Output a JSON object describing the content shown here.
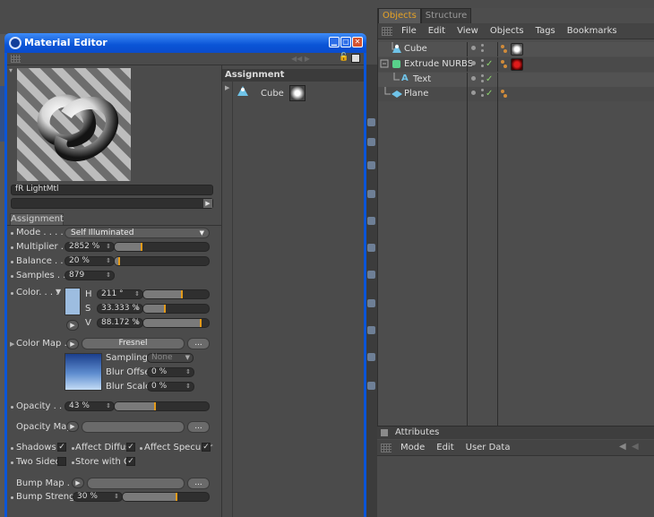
{
  "object_manager": {
    "tabs": [
      "Objects",
      "Structure"
    ],
    "menu": [
      "File",
      "Edit",
      "View",
      "Objects",
      "Tags",
      "Bookmarks"
    ],
    "objects": [
      {
        "name": "Cube",
        "icon": "cube-icon",
        "check": false
      },
      {
        "name": "Extrude NURBS",
        "icon": "extrude-nurbs-icon",
        "check": true
      },
      {
        "name": "Text",
        "icon": "text-spline-icon",
        "check": true
      },
      {
        "name": "Plane",
        "icon": "plane-icon",
        "check": true
      }
    ]
  },
  "attributes": {
    "title": "Attributes",
    "menu": [
      "Mode",
      "Edit",
      "User Data"
    ]
  },
  "material_editor": {
    "title": "Material Editor",
    "material_name": "fR LightMtl",
    "assignment_header": "Assignment",
    "assignment_item": "Cube",
    "tab": "Assignment",
    "mode": {
      "label": "Mode . . . . .",
      "value": "Self Illuminated"
    },
    "multiplier": {
      "label": "Multiplier . .",
      "value": "2852 %",
      "level": 0.29
    },
    "balance": {
      "label": "Balance . . .",
      "value": "20 %",
      "level": 0.05
    },
    "samples": {
      "label": "Samples . . .",
      "value": "879"
    },
    "color": {
      "label": "Color. . . .",
      "h_label": "H",
      "h_value": "211 °",
      "h_level": 0.59,
      "s_label": "S",
      "s_value": "33.333 %",
      "s_level": 0.33,
      "v_label": "V",
      "v_value": "88.172 %",
      "v_level": 0.88
    },
    "color_map": {
      "label": "Color Map . .",
      "shader": "Fresnel",
      "more": "...",
      "sampling_label": "Sampling",
      "sampling_value": "None",
      "blur_offset_label": "Blur Offset",
      "blur_offset_value": "0 %",
      "blur_scale_label": "Blur Scale",
      "blur_scale_value": "0 %"
    },
    "opacity": {
      "label": "Opacity . . . .",
      "value": "43 %",
      "level": 0.43
    },
    "opacity_map": {
      "label": "Opacity Map",
      "more": "..."
    },
    "flags": {
      "shadows": "Shadows",
      "affect_diffuse": "Affect Diffuse",
      "affect_specular": "Affect Specular",
      "two_sided": "Two Sided",
      "store_gi": "Store with GI"
    },
    "bump_map": {
      "label": "Bump Map . . .",
      "more": "..."
    },
    "bump_strength": {
      "label": "Bump Strength",
      "value": "30 %",
      "level": 0.62
    },
    "colors": {
      "accent": "#e39a1a",
      "check": "#8bd36b",
      "titlebar": "#0a55d8",
      "swatch": "#9dbde0"
    }
  }
}
